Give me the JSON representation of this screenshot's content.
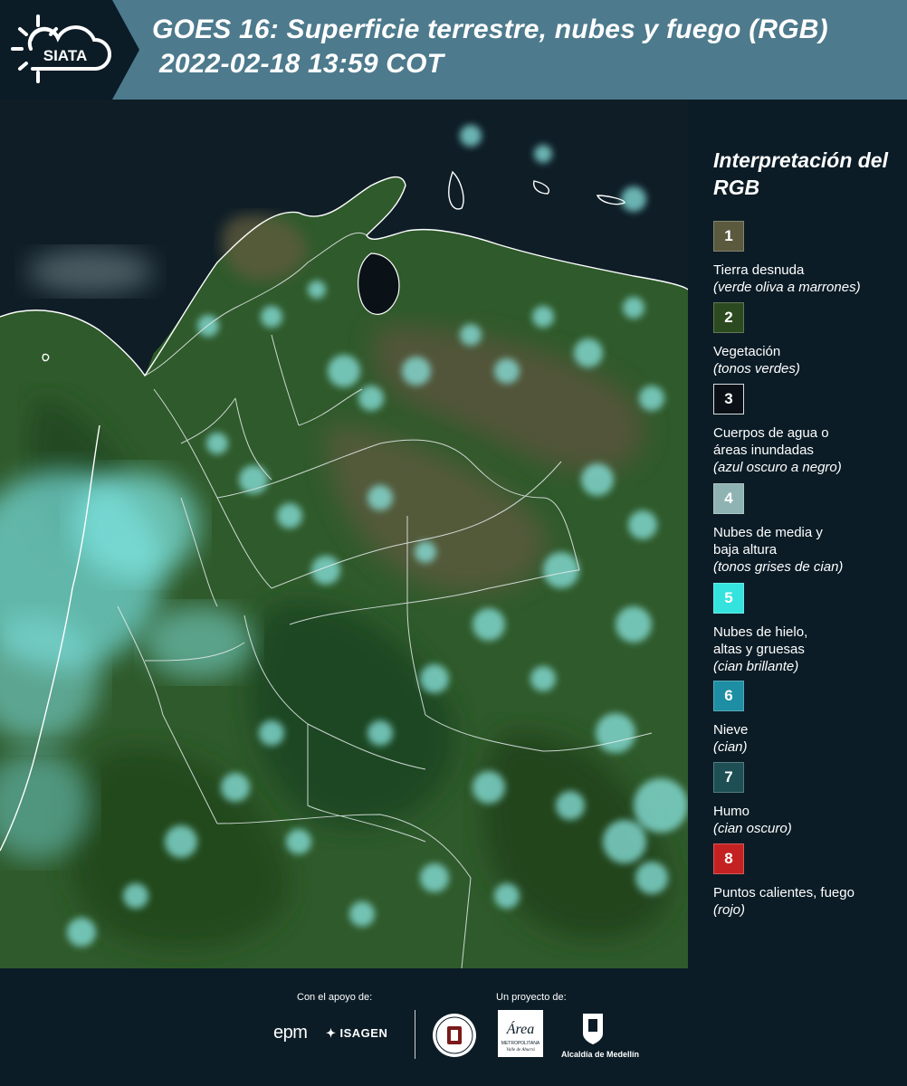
{
  "header": {
    "logo_text": "SIATA",
    "title_line1": "GOES 16: Superficie terrestre, nubes y fuego (RGB)",
    "title_line2": "2022-02-18 13:59 COT"
  },
  "legend": {
    "title": "Interpretación del RGB",
    "items": [
      {
        "number": "1",
        "label": "Tierra desnuda",
        "sublabel": "(verde oliva a marrones)",
        "color": "#5b5a3e"
      },
      {
        "number": "2",
        "label": "Vegetación",
        "sublabel": "(tonos verdes)",
        "color": "#2c4a1f"
      },
      {
        "number": "3",
        "label": "Cuerpos de agua o\náreas inundadas",
        "sublabel": "(azul oscuro a negro)",
        "color": "#0a1016"
      },
      {
        "number": "4",
        "label": "Nubes de media y\nbaja altura",
        "sublabel": "(tonos grises de cian)",
        "color": "#8fb3b2"
      },
      {
        "number": "5",
        "label": "Nubes de hielo,\naltas y gruesas",
        "sublabel": "(cian brillante)",
        "color": "#35e3de"
      },
      {
        "number": "6",
        "label": "Nieve",
        "sublabel": "(cian)",
        "color": "#1d8ea3"
      },
      {
        "number": "7",
        "label": "Humo",
        "sublabel": "(cian oscuro)",
        "color": "#1d4f54"
      },
      {
        "number": "8",
        "label": "Puntos calientes, fuego",
        "sublabel": "(rojo)",
        "color": "#c42222"
      }
    ]
  },
  "footer": {
    "support_label": "Con el apoyo de:",
    "project_label": "Un proyecto de:",
    "epm": "epm",
    "isagen": "ISAGEN",
    "area_logo_text": "Área",
    "area_logo_sub": "METROPOLITANA",
    "area_logo_sub2": "Valle de Aburrá",
    "medellin": "Alcaldía de Medellín"
  }
}
